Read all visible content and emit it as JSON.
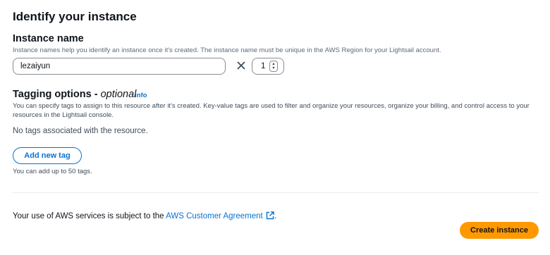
{
  "section": {
    "title": "Identify your instance"
  },
  "instance_name": {
    "label": "Instance name",
    "description": "Instance names help you identify an instance once it's created. The instance name must be unique in the AWS Region for your Lightsail account.",
    "value": "lezaiyun",
    "times_symbol": "×",
    "quantity": "1"
  },
  "tagging": {
    "title": "Tagging options",
    "dash": " - ",
    "optional": "optional",
    "info": "Info",
    "description": "You can specify tags to assign to this resource after it's created. Key-value tags are used to filter and organize your resources, organize your billing, and control access to your resources in the Lightsail console.",
    "empty_message": "No tags associated with the resource.",
    "add_button": "Add new tag",
    "limit_note": "You can add up to 50 tags."
  },
  "footer": {
    "agreement_prefix": "Your use of AWS services is subject to the ",
    "agreement_link": "AWS Customer Agreement",
    "agreement_suffix": ".",
    "create_button": "Create instance"
  },
  "colors": {
    "link": "#0972d3",
    "primary_button": "#ff9900",
    "text": "#0f141a",
    "muted_text": "#5f6b7a"
  },
  "icons": {
    "times": "times-icon",
    "stepper": "stepper-arrows-icon",
    "external": "external-link-icon"
  }
}
